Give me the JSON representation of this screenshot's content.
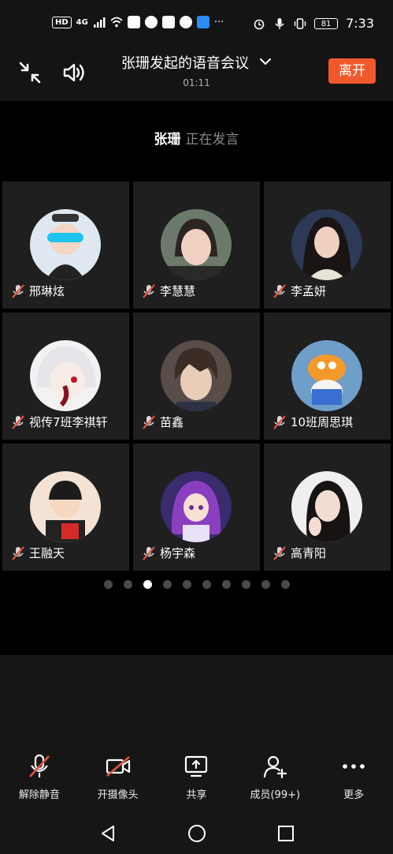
{
  "status_bar": {
    "network_badge": "HD",
    "network_type": "4G",
    "battery": "81",
    "time": "7:33",
    "more": "···"
  },
  "header": {
    "title": "张珊发起的语音会议",
    "timer": "01:11",
    "leave_label": "离开"
  },
  "speaker": {
    "name": "张珊",
    "status": "正在发言"
  },
  "participants": [
    {
      "name": "邢琳炫"
    },
    {
      "name": "李慧慧"
    },
    {
      "name": "李孟妍"
    },
    {
      "name": "视传7班李祺轩"
    },
    {
      "name": "苗鑫"
    },
    {
      "name": "10班周思琪"
    },
    {
      "name": "王融天"
    },
    {
      "name": "杨宇森"
    },
    {
      "name": "高青阳"
    }
  ],
  "pagination": {
    "total": 10,
    "current": 3
  },
  "toolbar": {
    "unmute": "解除静音",
    "camera": "开摄像头",
    "share": "共享",
    "members": "成员(99+)",
    "more": "更多"
  },
  "colors": {
    "accent": "#f2592a",
    "mute_red": "#e2543c",
    "tile_bg": "#1f1f1f"
  }
}
